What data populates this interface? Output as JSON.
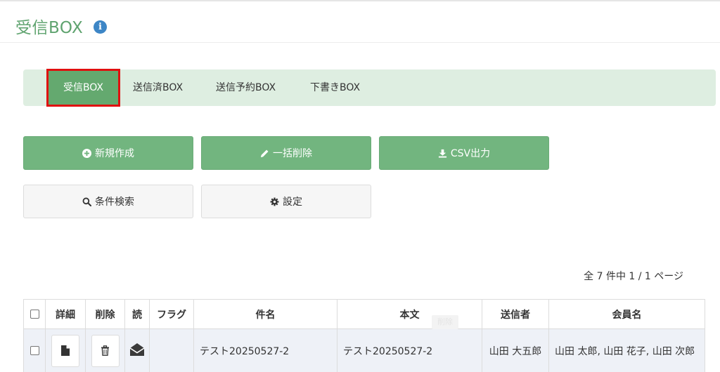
{
  "page": {
    "title": "受信BOX",
    "info_icon": "i"
  },
  "tabs": [
    {
      "label": "受信BOX",
      "active": true
    },
    {
      "label": "送信済BOX"
    },
    {
      "label": "送信予約BOX"
    },
    {
      "label": "下書きBOX"
    }
  ],
  "actions": {
    "new_label": "新規作成",
    "bulk_delete_label": "一括削除",
    "csv_label": "CSV出力",
    "search_label": "条件検索",
    "settings_label": "設定"
  },
  "pager": {
    "text": "全 7 件中 1 / 1 ページ"
  },
  "table": {
    "headers": {
      "detail": "詳細",
      "delete": "削除",
      "read": "読",
      "flag": "フラグ",
      "subject": "件名",
      "body": "本文",
      "sender": "送信者",
      "members": "会員名"
    },
    "rows": [
      {
        "subject": "テスト20250527-2",
        "body": "テスト20250527-2",
        "sender": "山田 大五郎",
        "members": "山田 太郎, 山田 花子, 山田 次郎"
      }
    ],
    "ghost_label": "削除"
  },
  "colors": {
    "brand_green": "#72b57f",
    "title_green": "#5fa36f",
    "tab_bar": "#deeee1",
    "highlight_red": "#e01010",
    "info_blue": "#3d86c6"
  },
  "icons": {
    "new": "plus-circle-icon",
    "bulk_delete": "pencil-icon",
    "csv": "download-icon",
    "search": "search-icon",
    "settings": "gear-icon",
    "detail": "file-icon",
    "delete": "trash-icon",
    "read": "envelope-open-icon"
  }
}
